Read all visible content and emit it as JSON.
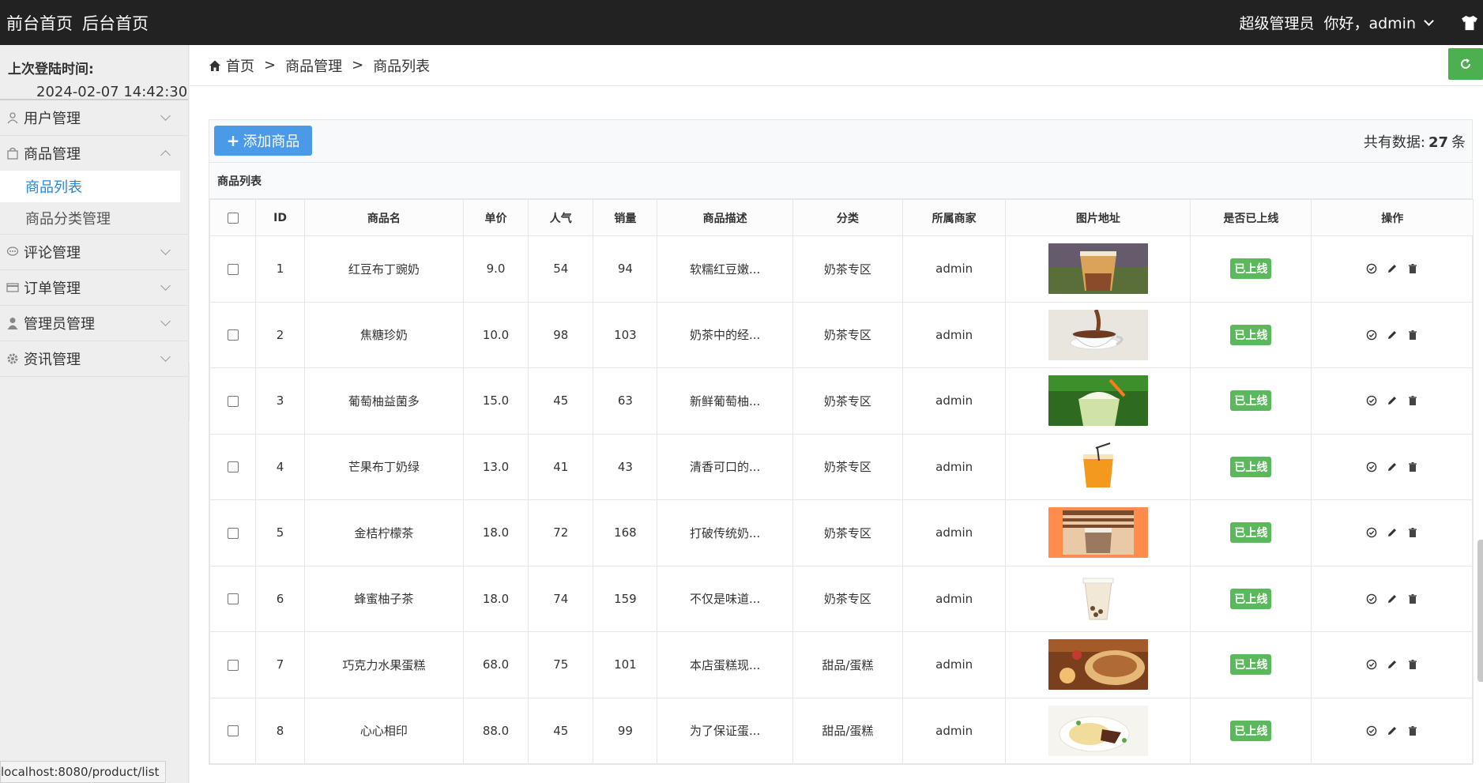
{
  "topbar": {
    "front_home": "前台首页",
    "back_home": "后台首页",
    "role": "超级管理员",
    "greeting": "你好，admin"
  },
  "sidebar": {
    "last_login_label": "上次登陆时间:",
    "last_login_time": "2024-02-07 14:42:30",
    "menus": [
      {
        "label": "用户管理",
        "icon": "user-icon"
      },
      {
        "label": "商品管理",
        "icon": "bag-icon"
      },
      {
        "label": "评论管理",
        "icon": "comment-icon"
      },
      {
        "label": "订单管理",
        "icon": "card-icon"
      },
      {
        "label": "管理员管理",
        "icon": "person-icon"
      },
      {
        "label": "资讯管理",
        "icon": "gear-icon"
      }
    ],
    "submenu": [
      "商品列表",
      "商品分类管理"
    ],
    "status_url": "localhost:8080/product/list"
  },
  "breadcrumb": {
    "home": "首页",
    "level1": "商品管理",
    "level2": "商品列表",
    "sep": ">"
  },
  "toolbar": {
    "add_label": "添加商品",
    "total_prefix": "共有数据:",
    "total_count": "27",
    "total_suffix": "条"
  },
  "panel_title": "商品列表",
  "table": {
    "headers": [
      "ID",
      "商品名",
      "单价",
      "人气",
      "销量",
      "商品描述",
      "分类",
      "所属商家",
      "图片地址",
      "是否已上线",
      "操作"
    ],
    "rows": [
      {
        "id": "1",
        "name": "红豆布丁豌奶",
        "price": "9.0",
        "pop": "54",
        "sales": "94",
        "desc": "软糯红豆嫩...",
        "cat": "奶茶专区",
        "merchant": "admin",
        "status": "已上线",
        "img": "red-bean-milk-tea"
      },
      {
        "id": "2",
        "name": "焦糖珍奶",
        "price": "10.0",
        "pop": "98",
        "sales": "103",
        "desc": "奶茶中的经...",
        "cat": "奶茶专区",
        "merchant": "admin",
        "status": "已上线",
        "img": "caramel-milk-tea"
      },
      {
        "id": "3",
        "name": "葡萄柚益菌多",
        "price": "15.0",
        "pop": "45",
        "sales": "63",
        "desc": "新鲜葡萄柚...",
        "cat": "奶茶专区",
        "merchant": "admin",
        "status": "已上线",
        "img": "matcha-drink"
      },
      {
        "id": "4",
        "name": "芒果布丁奶绿",
        "price": "13.0",
        "pop": "41",
        "sales": "43",
        "desc": "清香可口的...",
        "cat": "奶茶专区",
        "merchant": "admin",
        "status": "已上线",
        "img": "mango-cup"
      },
      {
        "id": "5",
        "name": "金桔柠檬茶",
        "price": "18.0",
        "pop": "72",
        "sales": "168",
        "desc": "打破传统奶...",
        "cat": "奶茶专区",
        "merchant": "admin",
        "status": "已上线",
        "img": "kumquat-tea"
      },
      {
        "id": "6",
        "name": "蜂蜜柚子茶",
        "price": "18.0",
        "pop": "74",
        "sales": "159",
        "desc": "不仅是味道...",
        "cat": "奶茶专区",
        "merchant": "admin",
        "status": "已上线",
        "img": "honey-tea-cup"
      },
      {
        "id": "7",
        "name": "巧克力水果蛋糕",
        "price": "68.0",
        "pop": "75",
        "sales": "101",
        "desc": "本店蛋糕现...",
        "cat": "甜品/蛋糕",
        "merchant": "admin",
        "status": "已上线",
        "img": "choco-fruit-cake"
      },
      {
        "id": "8",
        "name": "心心相印",
        "price": "88.0",
        "pop": "45",
        "sales": "99",
        "desc": "为了保证蛋...",
        "cat": "甜品/蛋糕",
        "merchant": "admin",
        "status": "已上线",
        "img": "crepe-dessert"
      }
    ]
  },
  "colors": {
    "topbar": "#222222",
    "accent_blue": "#4b9ae8",
    "active_link": "#1e88e5",
    "online_badge": "#5cb85c",
    "refresh_green": "#4caf50"
  }
}
